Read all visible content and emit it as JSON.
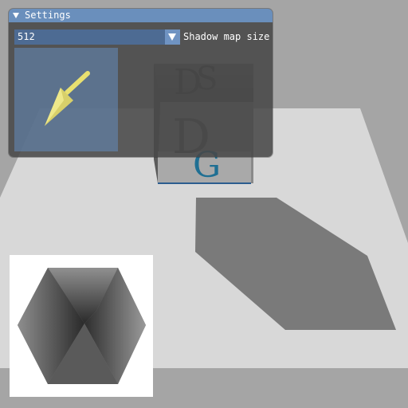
{
  "settings_window": {
    "title": "Settings",
    "shadow_map_size": {
      "value": "512",
      "label": "Shadow map size"
    }
  },
  "scene": {
    "cube_face_letters": [
      "S",
      "D",
      "D",
      "G",
      "G"
    ]
  },
  "colors": {
    "accent": "#6a8fbc",
    "combo_bg": "#4d6b93",
    "ground": "#d8d8d8",
    "shadow": "#7a7a7a",
    "light_arrow": "#e8e070"
  },
  "icons": {
    "collapse": "triangle-down-icon",
    "dropdown": "chevron-down-icon",
    "light_direction": "arrow-icon"
  }
}
